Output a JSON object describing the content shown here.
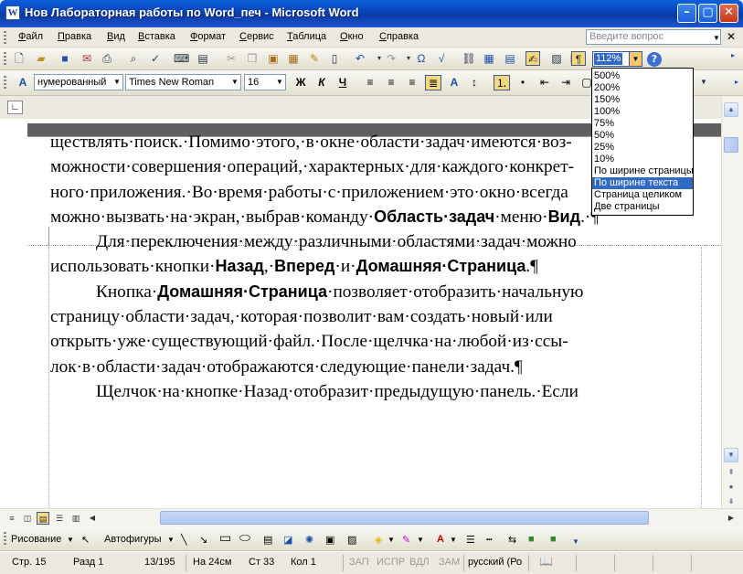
{
  "window": {
    "title": "Нов Лабораторная работы по Word_печ - Microsoft Word",
    "app_icon_letter": "W"
  },
  "menu": {
    "items": [
      "Файл",
      "Правка",
      "Вид",
      "Вставка",
      "Формат",
      "Сервис",
      "Таблица",
      "Окно",
      "Справка"
    ],
    "ask_placeholder": "Введите вопрос"
  },
  "formatting": {
    "style": "нумерованный",
    "font": "Times New Roman",
    "size": "16",
    "bold_label": "Ж",
    "italic_label": "К",
    "underline_label": "Ч"
  },
  "zoom": {
    "value": "112%",
    "options": [
      "500%",
      "200%",
      "150%",
      "100%",
      "75%",
      "50%",
      "25%",
      "10%",
      "По ширине страницы",
      "По ширине текста",
      "Страница целиком",
      "Две страницы"
    ],
    "selected": "По ширине текста"
  },
  "document": {
    "lines": [
      [
        "ществлять·поиск.·Помимо·этого,·в·окне·области·задач·имеются·воз-"
      ],
      [
        "можности·совершения·операций,·характерных·для·каждого·конкрет-"
      ],
      [
        "ного·приложения.·Во·время·работы·с·приложением·это·окно·всегда"
      ],
      [
        "можно·вызвать·на·экран,·выбрав·команду·",
        "Область·задач",
        "·меню·",
        "Вид",
        ".·¶"
      ],
      [
        "Для·переключения·между·различными·областями·задач·можно"
      ],
      [
        "использовать·кнопки·",
        "Назад",
        ",·",
        "Вперед",
        "·и·",
        "Домашняя·Страница",
        ".¶"
      ],
      [
        "Кнопка·",
        "Домашняя·Страница",
        "·позволяет·отобразить·начальную"
      ],
      [
        "страницу·области·задач,·которая·позволит·вам·создать·новый·или"
      ],
      [
        "открыть·уже·существующий·файл.·После·щелчка·на·любой·из·ссы-"
      ],
      [
        "лок·в·области·задач·отображаются·следующие·панели·задач.¶"
      ],
      [
        "Щелчок·на·кнопке·Назад·отобразит·предыдущую·панель.·Если"
      ]
    ],
    "bold_flags": [
      [
        false
      ],
      [
        false
      ],
      [
        false
      ],
      [
        false,
        true,
        false,
        true,
        false
      ],
      [
        false
      ],
      [
        false,
        true,
        false,
        true,
        false,
        true,
        false
      ],
      [
        false,
        true,
        false
      ],
      [
        false
      ],
      [
        false
      ],
      [
        false
      ],
      [
        false
      ]
    ],
    "indent_flags": [
      false,
      false,
      false,
      false,
      true,
      false,
      true,
      false,
      false,
      false,
      true
    ]
  },
  "drawing": {
    "draw_label": "Рисование",
    "autoshapes_label": "Автофигуры"
  },
  "status": {
    "page": "Стр.  15",
    "section": "Разд  1",
    "pages": "13/195",
    "at": "На  24см",
    "line": "Ст  33",
    "col": "Кол  1",
    "rec": "ЗАП",
    "trk": "ИСПР",
    "ext": "ВДЛ",
    "ovr": "ЗАМ",
    "language": "русский (Ро"
  },
  "colors": {
    "titlebar": "#0842b8",
    "selection": "#316ac5",
    "active_button": "#f6d77a"
  }
}
